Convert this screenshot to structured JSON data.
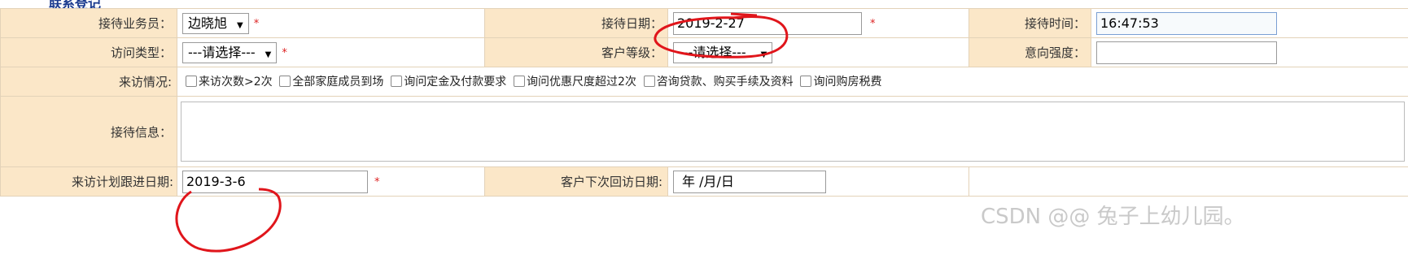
{
  "section_title": "联系登记",
  "row1": {
    "agent_label": "接待业务员：",
    "agent_value": "边晓旭",
    "date_label": "接待日期：",
    "date_value": "2019-2-27",
    "time_label": "接待时间：",
    "time_value": "16:47:53"
  },
  "row2": {
    "visit_type_label": "访问类型：",
    "visit_type_value": "---请选择---",
    "level_label": "客户等级：",
    "level_value": "---请选择---",
    "intent_label": "意向强度：",
    "intent_value": ""
  },
  "row3": {
    "situation_label": "来访情况:",
    "options": [
      "来访次数>2次",
      "全部家庭成员到场",
      "询问定金及付款要求",
      "询问优惠尺度超过2次",
      "咨询贷款、购买手续及资料",
      "询问购房税费"
    ]
  },
  "row4": {
    "info_label": "接待信息：",
    "info_value": ""
  },
  "row5": {
    "plan_label": "来访计划跟进日期:",
    "plan_value": "2019-3-6",
    "next_label": "客户下次回访日期:",
    "next_value": "年 /月/日"
  },
  "required_mark": "*",
  "watermark": "CSDN @@ 兔子上幼儿园。",
  "colors": {
    "label_bg": "#fbe7c8",
    "annotation": "#e0151b",
    "title": "#1b3b8f"
  }
}
